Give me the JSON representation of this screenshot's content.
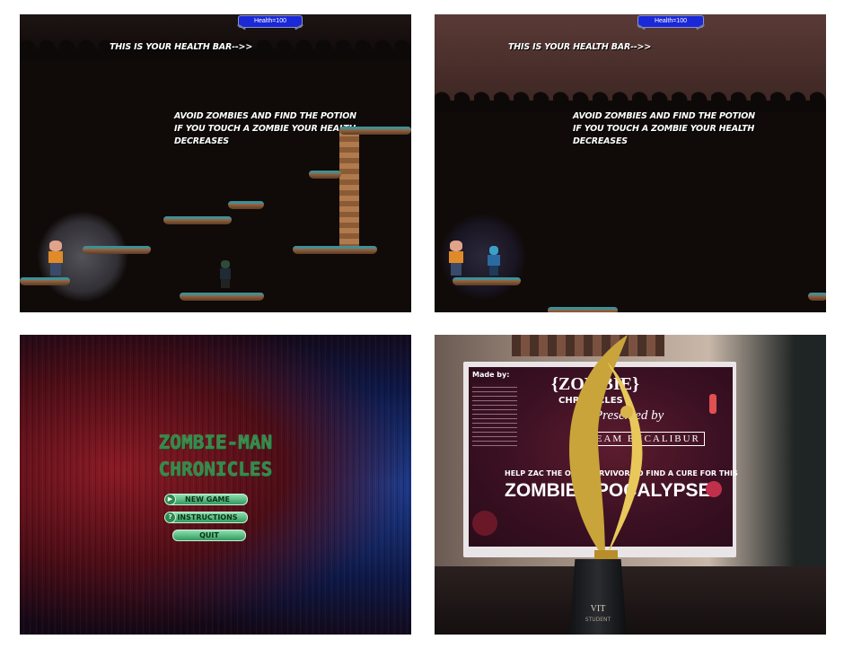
{
  "panels": {
    "scene1": {
      "health_bar": "Health=100",
      "hint_healthbar": "THIS IS YOUR HEALTH BAR-->>",
      "instructions": [
        "AVOID ZOMBIES AND FIND THE POTION",
        "IF YOU TOUCH A ZOMBIE YOUR HEALTH",
        "DECREASES"
      ]
    },
    "scene2": {
      "health_bar": "Health=100",
      "hint_healthbar": "THIS IS YOUR HEALTH BAR-->>",
      "instructions": [
        "AVOID ZOMBIES AND FIND THE POTION",
        "IF YOU TOUCH A ZOMBIE YOUR HEALTH",
        "DECREASES"
      ]
    },
    "menu": {
      "title_line1": "ZOMBIE-MAN",
      "title_line2": "CHRONICLES",
      "buttons": [
        {
          "label": "NEW GAME",
          "icon": "play-icon",
          "glyph": "▶"
        },
        {
          "label": "INSTRUCTIONS",
          "icon": "help-icon",
          "glyph": "?"
        },
        {
          "label": "QUIT",
          "icon": "",
          "glyph": ""
        }
      ]
    },
    "photo": {
      "made_by": "Made by:",
      "logo_line1": "{ZOMBIE}",
      "logo_line2": "CHRONICLES",
      "presented": "Presented by",
      "team": "TEAM EXCALIBUR",
      "tagline": "HELP ZAC THE ONLY SURVIVOR TO FIND A CURE FOR THIS",
      "headline": "ZOMBIE APOCALYPSE.",
      "trophy_plate": "VIT",
      "trophy_plate2": "STUDENT"
    }
  },
  "colors": {
    "health_bar": "#1a28d8",
    "platform_top": "#3f8f96",
    "menu_title": "#2f8c4a",
    "menu_button": "#3fa866"
  }
}
